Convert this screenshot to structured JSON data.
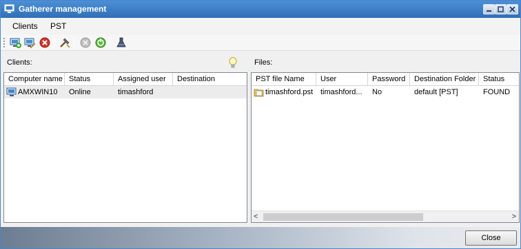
{
  "window": {
    "title": "Gatherer management"
  },
  "menu": {
    "items": [
      "Clients",
      "PST"
    ]
  },
  "toolbar": {
    "buttons": [
      "add-client-icon",
      "edit-client-icon",
      "remove-client-icon",
      "tools-icon",
      "stop-icon",
      "start-icon",
      "flask-icon"
    ]
  },
  "clients_pane": {
    "label": "Clients:",
    "columns": [
      "Computer name",
      "Status",
      "Assigned user",
      "Destination"
    ],
    "rows": [
      {
        "computer_name": "AMXWIN10",
        "status": "Online",
        "assigned_user": "timashford",
        "destination": ""
      }
    ]
  },
  "files_pane": {
    "label": "Files:",
    "columns": [
      "PST file Name",
      "User",
      "Password",
      "Destination Folder",
      "Status"
    ],
    "rows": [
      {
        "file_name": "timashford.pst",
        "user": "timashford...",
        "password": "No",
        "destination_folder": "default [PST]",
        "status": "FOUND"
      }
    ]
  },
  "footer": {
    "close_label": "Close"
  }
}
